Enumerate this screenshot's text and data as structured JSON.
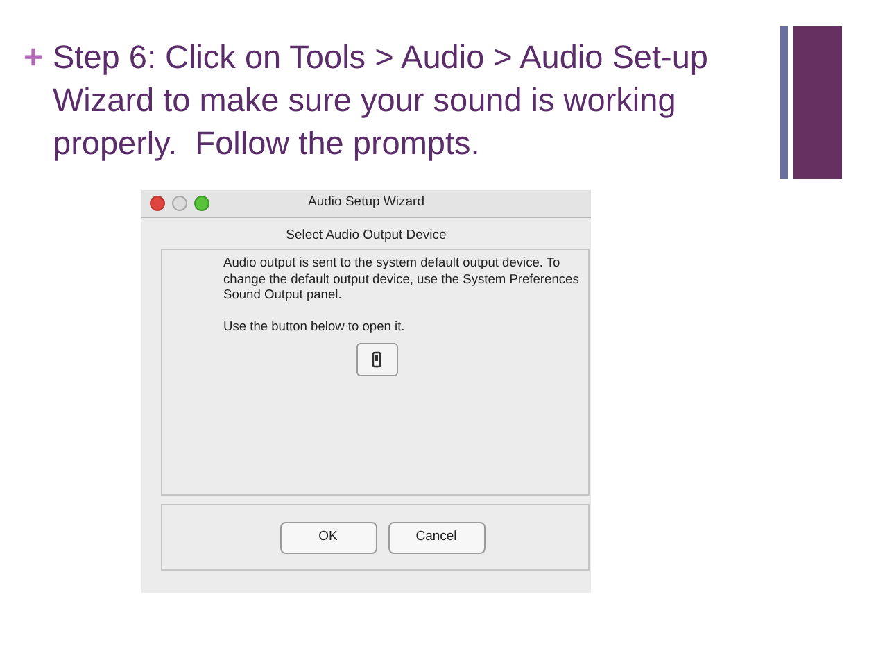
{
  "slide": {
    "bullet": "+",
    "text": "Step 6: Click on Tools > Audio > Audio Set-up\nWizard to make sure your sound is working\nproperly.  Follow the prompts."
  },
  "dialog": {
    "title": "Audio Setup Wizard",
    "heading": "Select Audio Output Device",
    "paragraphs": [
      "Audio output is sent to the system default output device. To change the default output device, use the System Preferences\n Sound Output panel.",
      "Use the button below to open it."
    ],
    "buttons": [
      "OK",
      "Cancel"
    ]
  }
}
